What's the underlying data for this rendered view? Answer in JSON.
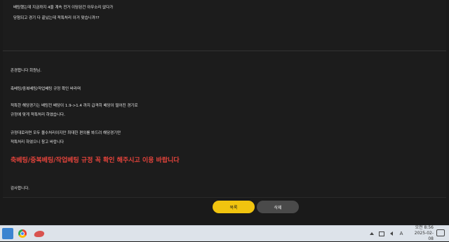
{
  "question": {
    "line1": "배팅했는데 지금까지 4을 계속 전거 이당된건 아무소리 없다가",
    "line2": "당첨되고 경기 다 끝났는데 적특처리 이거 맞습니까??"
  },
  "answer": {
    "greeting": "존경합니다 회원님.",
    "notice_title": "축베팅/중복베팅/작업베팅 규정 확인 바라며",
    "body1": "적특한 해당경기는 배팅전 배당이 1.9->1.4 까지 급격히 배당이 떨어진 경기로",
    "body2": "규정에 맞게 적특처리 하였습니다.",
    "body3": "규정대로라면 모두 몰수처리이지만 최대한 편의를 봐드려 해당경기만",
    "body4": "적특처리 하였으니 참고 바랍니다",
    "warning": "축베팅/중복베팅/작업베팅 규정 꼭 확인 해주시고 이용 바랍니다",
    "closing": "감사합니다."
  },
  "buttons": {
    "confirm": "목록",
    "delete": "삭제"
  },
  "taskbar": {
    "ime": "A",
    "time_period": "오전 8:56",
    "date": "2025-02-08"
  },
  "colors": {
    "accent": "#f1c40f",
    "warning": "#e4433b",
    "background": "#1a1a1a"
  },
  "icons": [
    "start-icon",
    "chrome-icon",
    "app-icon",
    "tray-up-arrow-icon",
    "network-icon",
    "volume-icon",
    "notification-icon"
  ]
}
